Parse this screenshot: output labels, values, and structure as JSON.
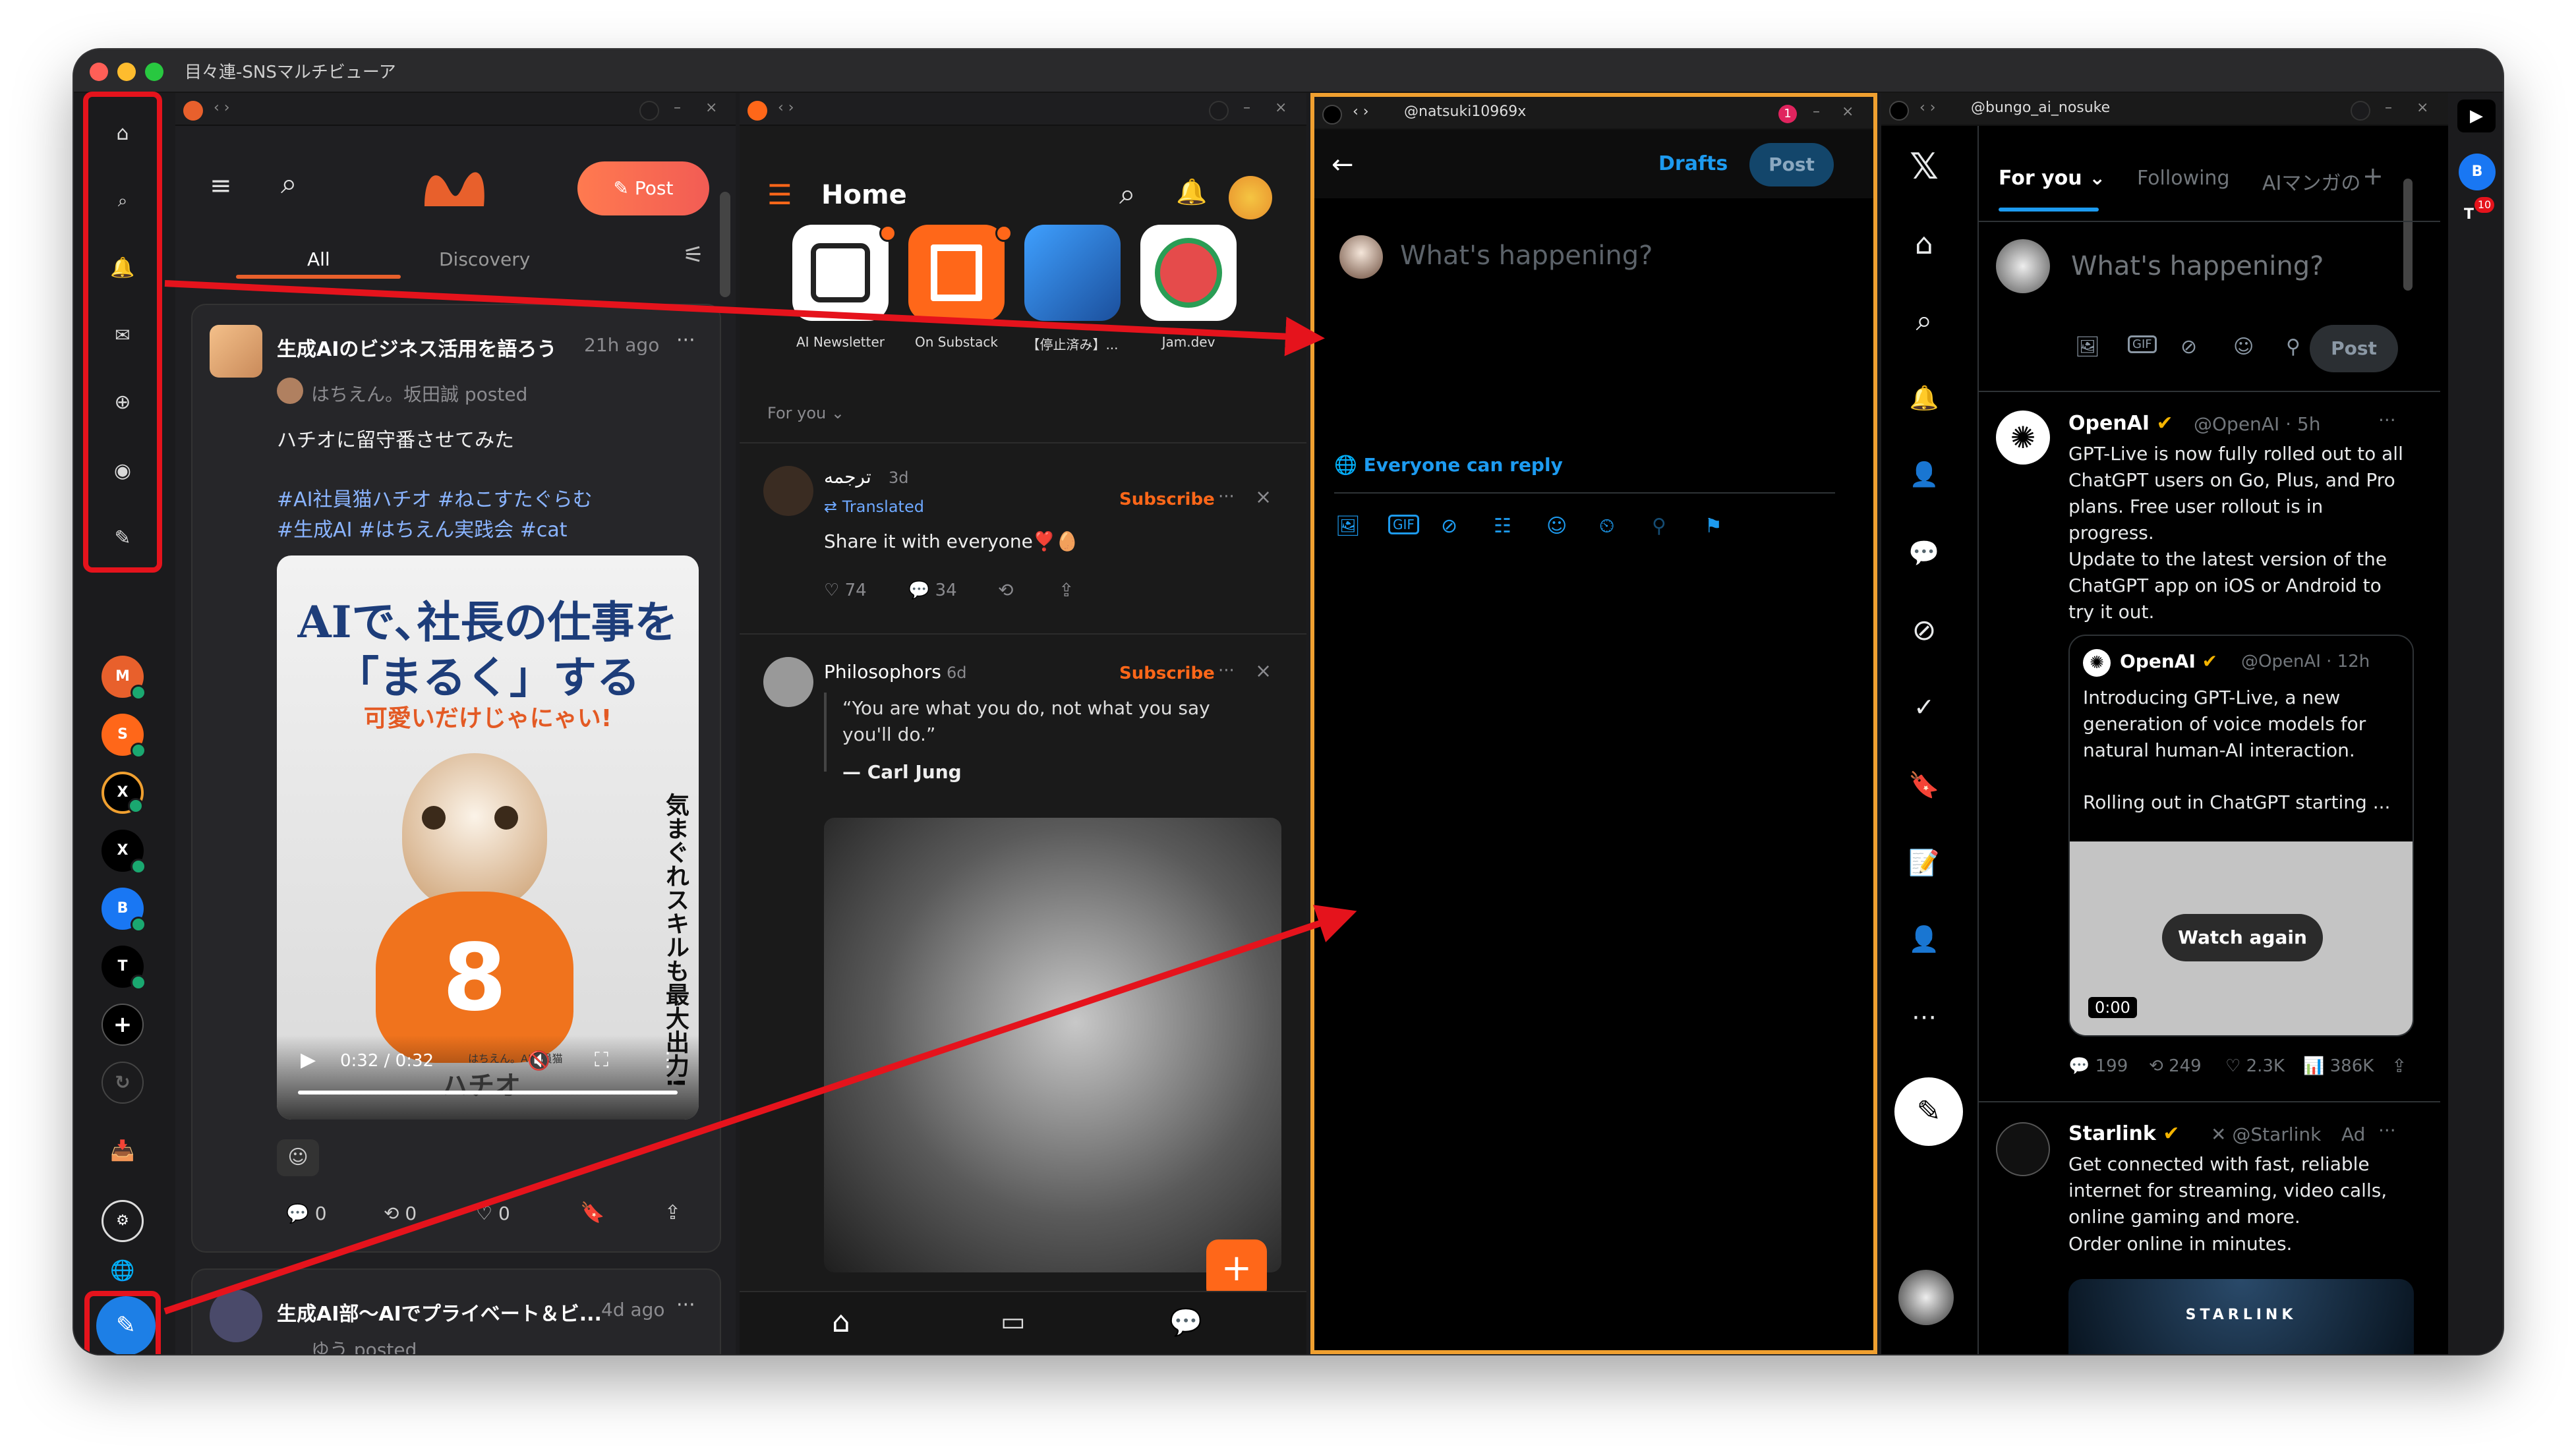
{
  "window": {
    "title": "目々連-SNSマルチビューア"
  },
  "panes": {
    "substack": {
      "account": "",
      "nav_title": "Home"
    },
    "compose": {
      "account": "@natsuki10969x",
      "badge": "1"
    },
    "x": {
      "account": "@bungo_ai_nosuke"
    }
  },
  "sidebar": {
    "accounts": [
      {
        "letter": "M",
        "color": "#e8602c"
      },
      {
        "letter": "S",
        "color": "#ff6719"
      },
      {
        "letter": "X",
        "color": "#000000"
      },
      {
        "letter": "X",
        "color": "#000000"
      },
      {
        "letter": "B",
        "color": "#1977f3"
      },
      {
        "letter": "T",
        "color": "#000000"
      }
    ]
  },
  "misskey": {
    "post_button": "Post",
    "tabs": [
      "All",
      "Discovery"
    ],
    "note1": {
      "community": "生成AIのビジネス活用を語ろう",
      "time": "21h ago",
      "poster": "はちえん。坂田誠 posted",
      "text": "ハチオに留守番させてみた",
      "hashtags_line1": "#AI社員猫ハチオ #ねこすたぐらむ",
      "hashtags_line2": "#生成AI #はちえん実践会 #cat",
      "image_title_line1": "AIで､社長の仕事を",
      "image_title_line2": "「まるく」する",
      "image_subtitle": "可愛いだけじゃにゃい!",
      "image_number": "8",
      "image_side_text": "気まぐれスキルも最大出力!",
      "image_credit": "はちえん。AI社員猫",
      "image_name": "ハチオ",
      "video_time": "0:32 / 0:32",
      "counts": {
        "replies": "0",
        "renotes": "0",
        "reactions": "0"
      }
    },
    "note2": {
      "community": "生成AI部〜AIでプライベート＆ビ...",
      "time": "4d ago",
      "poster": "ゆう posted"
    }
  },
  "substack": {
    "title": "Home",
    "pubs": [
      "AI Newsletter",
      "On Substack",
      "【停止済み】...",
      "Jam.dev"
    ],
    "filter": "For you",
    "post1": {
      "author": "ترجمه",
      "time": "3d",
      "subscribe": "Subscribe",
      "translated": "Translated",
      "text": "Share it with everyone❣️🥚",
      "likes": "74",
      "comments": "34"
    },
    "post2": {
      "author": "Philosophors",
      "time": "6d",
      "subscribe": "Subscribe",
      "quote": "“You are what you do, not what you say you'll do.”",
      "attribution": "— Carl Jung"
    }
  },
  "compose": {
    "drafts": "Drafts",
    "post": "Post",
    "placeholder": "What's happening?",
    "reply_setting": "Everyone can reply"
  },
  "x": {
    "tabs": [
      "For you",
      "Following",
      "AIマンガの"
    ],
    "compose_placeholder": "What's happening?",
    "compose_post": "Post",
    "tweet1": {
      "name": "OpenAI",
      "handle": "@OpenAI · 5h",
      "text1": "GPT-Live is now fully rolled out to all ChatGPT users on Go, Plus, and Pro plans. Free user rollout is in progress.",
      "text2": "Update to the latest version of the ChatGPT app on iOS or Android to try it out.",
      "quote_name": "OpenAI",
      "quote_handle": "@OpenAI · 12h",
      "quote_text": "Introducing GPT-Live, a new generation of voice models for natural human-AI interaction.",
      "quote_text2": "Rolling out in ChatGPT starting ...",
      "watch_again": "Watch again",
      "video_time": "0:00",
      "replies": "199",
      "reposts": "249",
      "likes": "2.3K",
      "views": "386K"
    },
    "tweet2": {
      "name": "Starlink",
      "handle": "@Starlink",
      "ad": "Ad",
      "text1": "Get connected with fast, reliable internet for streaming, video calls, online gaming and more.",
      "text2": "Order online in minutes.",
      "card_text": "STARLINK"
    },
    "right_rail": {
      "badge": "10",
      "avatar_b": "B",
      "avatar_t": "T"
    }
  }
}
